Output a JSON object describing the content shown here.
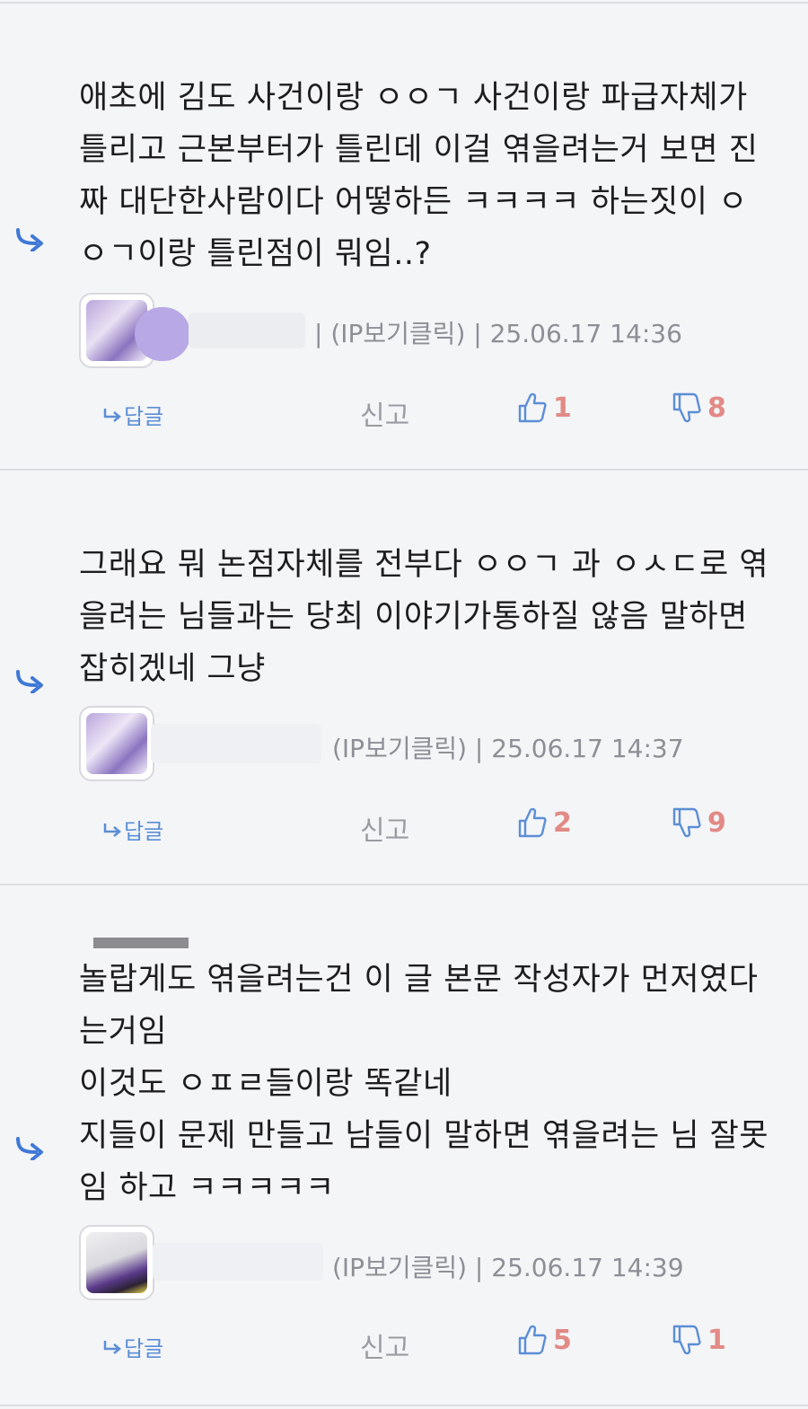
{
  "comments": [
    {
      "text": "애초에 김도 사건이랑 ㅇㅇㄱ 사건이랑 파급자체가\n틀리고 근본부터가 틀린데 이걸 엮을려는거 보면 진\n짜 대단한사람이다 어떻하든 ㅋㅋㅋㅋ 하는짓이 ㅇ\nㅇㄱ이랑 틀린점이 뭐임..?",
      "meta": "| (IP보기클릭) | 25.06.17 14:36",
      "reply_label": "답글",
      "report_label": "신고",
      "likes": "1",
      "dislikes": "8"
    },
    {
      "text": "그래요 뭐 논점자체를 전부다 ㅇㅇㄱ 과 ㅇㅅㄷ로 엮\n을려는 님들과는 당최 이야기가통하질 않음 말하면\n잡히겠네 그냥",
      "meta": "(IP보기클릭) | 25.06.17 14:37",
      "reply_label": "답글",
      "report_label": "신고",
      "likes": "2",
      "dislikes": "9"
    },
    {
      "text": "놀랍게도 엮을려는건 이 글 본문 작성자가 먼저였다\n는거임\n이것도 ㅇㅍㄹ들이랑 똑같네\n지들이 문제 만들고 남들이 말하면 엮을려는 님 잘못\n임 하고 ㅋㅋㅋㅋㅋ",
      "meta": "(IP보기클릭) | 25.06.17 14:39",
      "reply_label": "답글",
      "report_label": "신고",
      "likes": "5",
      "dislikes": "1"
    }
  ],
  "icons": {
    "reply_arrow": "reply-arrow-icon",
    "reply_small": "reply-small-arrow-icon",
    "like": "thumbs-up-icon",
    "dislike": "thumbs-down-icon"
  },
  "colors": {
    "background": "#f4f5f7",
    "accent_blue": "#5b8ed6",
    "count_red": "#e28a86",
    "meta_grey": "#8d8f96"
  }
}
